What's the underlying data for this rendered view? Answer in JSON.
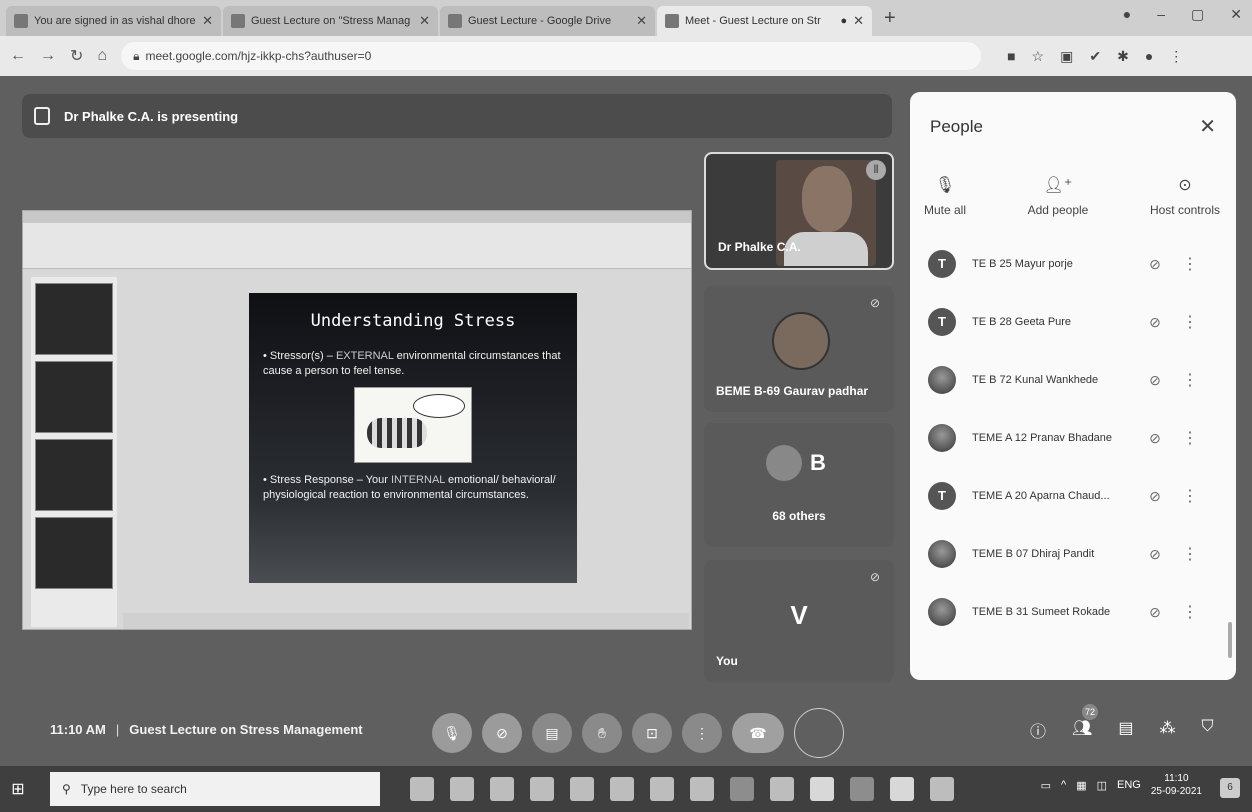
{
  "tabs": [
    {
      "title": "You are signed in as vishal dhore",
      "active": false
    },
    {
      "title": "Guest Lecture on \"Stress Manag",
      "active": false
    },
    {
      "title": "Guest Lecture - Google Drive",
      "active": false
    },
    {
      "title": "Meet - Guest Lecture on Str",
      "active": true
    }
  ],
  "address": {
    "url": "meet.google.com/hjz-ikkp-chs?authuser=0"
  },
  "presenting_banner": "Dr Phalke C.A. is presenting",
  "slide": {
    "title": "Understanding Stress",
    "bullet1_a": "Stressor(s) – ",
    "bullet1_hl": "EXTERNAL",
    "bullet1_b": " environmental circumstances that cause a person to feel tense.",
    "bullet2_a": "Stress Response – Your ",
    "bullet2_hl": "INTERNAL",
    "bullet2_b": " emotional/ behavioral/ physiological reaction to environmental circumstances."
  },
  "tiles": {
    "presenter": "Dr Phalke C.A.",
    "participant": "BEME B-69 Gaurav padhar",
    "others_letter": "B",
    "others": "68 others",
    "self_letter": "V",
    "self": "You"
  },
  "people_panel": {
    "title": "People",
    "actions": {
      "mute_all": "Mute all",
      "add_people": "Add people",
      "host_controls": "Host controls"
    },
    "participants": [
      {
        "initial": "T",
        "name": "TE B 25 Mayur porje",
        "photo": false
      },
      {
        "initial": "T",
        "name": "TE B 28 Geeta Pure",
        "photo": false
      },
      {
        "initial": "",
        "name": "TE B 72 Kunal Wankhede",
        "photo": true
      },
      {
        "initial": "",
        "name": "TEME A 12 Pranav Bhadane",
        "photo": true
      },
      {
        "initial": "T",
        "name": "TEME A 20 Aparna Chaud...",
        "photo": false
      },
      {
        "initial": "",
        "name": "TEME B 07 Dhiraj Pandit",
        "photo": true
      },
      {
        "initial": "",
        "name": "TEME B 31 Sumeet Rokade",
        "photo": true
      }
    ]
  },
  "meeting": {
    "time": "11:10 AM",
    "title": "Guest Lecture on Stress Management",
    "people_count": "72"
  },
  "taskbar": {
    "search_placeholder": "Type here to search",
    "clock_time": "11:10",
    "clock_date": "25-09-2021",
    "lang": "ENG",
    "notifications": "6"
  }
}
